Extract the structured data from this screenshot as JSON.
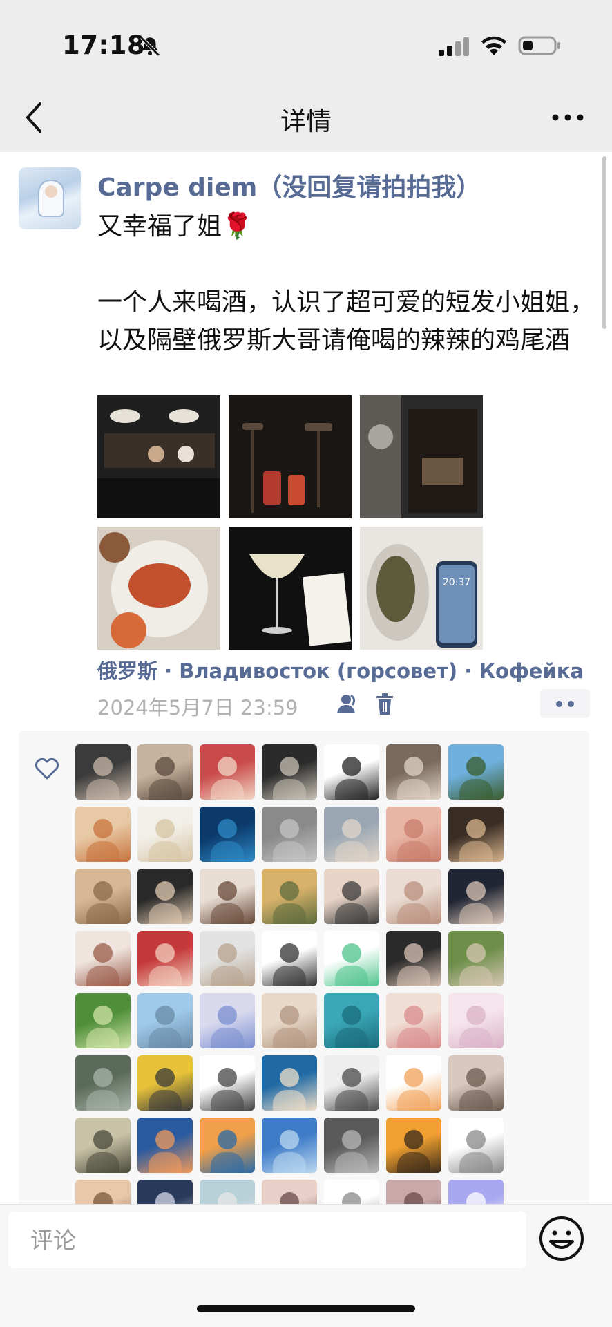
{
  "status_bar": {
    "time": "17:18"
  },
  "nav": {
    "title": "详情"
  },
  "post": {
    "username": "Carpe diem（没回复请拍拍我）",
    "text": "又幸福了姐🌹\n\n一个人来喝酒，认识了超可爱的短发小姐姐，以及隔壁俄罗斯大哥请俺喝的辣辣的鸡尾酒",
    "location": "俄罗斯 · Владивосток (горсовет) · Кофейка",
    "timestamp": "2024年5月7日 23:59"
  },
  "photo_tones": [
    [
      "#1f1f1f",
      "#4a3a2c"
    ],
    [
      "#1a1614",
      "#8a2b25"
    ],
    [
      "#2b2b2b",
      "#6d6a66"
    ],
    [
      "#d8cfc4",
      "#b8452a"
    ],
    [
      "#101010",
      "#e8e2c9"
    ],
    [
      "#9fb3c9",
      "#48532f"
    ]
  ],
  "liker_tones": [
    [
      "#3b3b3b",
      "#c9b8a9"
    ],
    [
      "#c7b29d",
      "#5b4a3e"
    ],
    [
      "#c94b4b",
      "#f2d7c6"
    ],
    [
      "#2b2b2b",
      "#c8c2b5"
    ],
    [
      "#ffffff",
      "#222222"
    ],
    [
      "#7a6a5e",
      "#e1d5c7"
    ],
    [
      "#6fb0de",
      "#3a5c2b"
    ],
    [
      "#e8c9a5",
      "#c8733d"
    ],
    [
      "#f2efe8",
      "#d7c4a3"
    ],
    [
      "#0c3a6b",
      "#2d8ac6"
    ],
    [
      "#8a8a8a",
      "#c4c4c4"
    ],
    [
      "#9aa7b3",
      "#e2d5c9"
    ],
    [
      "#e9b6a6",
      "#c87c6b"
    ],
    [
      "#3a2d24",
      "#d8b58e"
    ],
    [
      "#d6b897",
      "#8a6a48"
    ],
    [
      "#2a2a2a",
      "#e0c9b0"
    ],
    [
      "#e8ddd3",
      "#6a4a3a"
    ],
    [
      "#d8b26b",
      "#5d6b3c"
    ],
    [
      "#e8d4c6",
      "#3a3a3a"
    ],
    [
      "#eadcd2",
      "#b98f7d"
    ],
    [
      "#202633",
      "#d9c5b7"
    ],
    [
      "#efe5de",
      "#9b5b4a"
    ],
    [
      "#c43a3a",
      "#f2cfc0"
    ],
    [
      "#e2e2e2",
      "#b8a38e"
    ],
    [
      "#ffffff",
      "#333333"
    ],
    [
      "#ffffff",
      "#4ec38c"
    ],
    [
      "#2a2a2a",
      "#d8c2b4"
    ],
    [
      "#6e8f4a",
      "#d6c6b3"
    ],
    [
      "#4f8f3a",
      "#cfe3a5"
    ],
    [
      "#9ec9e8",
      "#6a8aa6"
    ],
    [
      "#d9d9ee",
      "#7a8fd0"
    ],
    [
      "#e8d8c8",
      "#b29580"
    ],
    [
      "#3aa7b8",
      "#1b6c7a"
    ],
    [
      "#f0ded4",
      "#d88c8c"
    ],
    [
      "#f6e4ec",
      "#d9b3c6"
    ],
    [
      "#5b6b5b",
      "#a8b3a8"
    ],
    [
      "#e8c33a",
      "#3a3a3a"
    ],
    [
      "#ffffff",
      "#444444"
    ],
    [
      "#1f6aa5",
      "#f2e0c8"
    ],
    [
      "#eeeeee",
      "#4a4a4a"
    ],
    [
      "#ffffff",
      "#f0a25a"
    ],
    [
      "#d8c8be",
      "#6a5a4e"
    ],
    [
      "#c8c2a6",
      "#4a4a3a"
    ],
    [
      "#2a5aa0",
      "#f29a5a"
    ],
    [
      "#f0a04a",
      "#2a6aa8"
    ],
    [
      "#3f7cc8",
      "#bcd8f0"
    ],
    [
      "#5a5a5a",
      "#b8b8b8"
    ],
    [
      "#f0a030",
      "#3a2a1a"
    ],
    [
      "#ffffff",
      "#888888"
    ],
    [
      "#e8c8a8",
      "#7a5a3a"
    ],
    [
      "#2a3a5a",
      "#d8d8e8"
    ],
    [
      "#b8d0d8",
      "#e8e8e8"
    ],
    [
      "#e8d0c8",
      "#6a4a4a"
    ],
    [
      "#ffffff",
      "#8a8a8a"
    ],
    [
      "#c8a8a8",
      "#6a4a4a"
    ],
    [
      "#a8a8f0",
      "#ffffff"
    ]
  ]
}
